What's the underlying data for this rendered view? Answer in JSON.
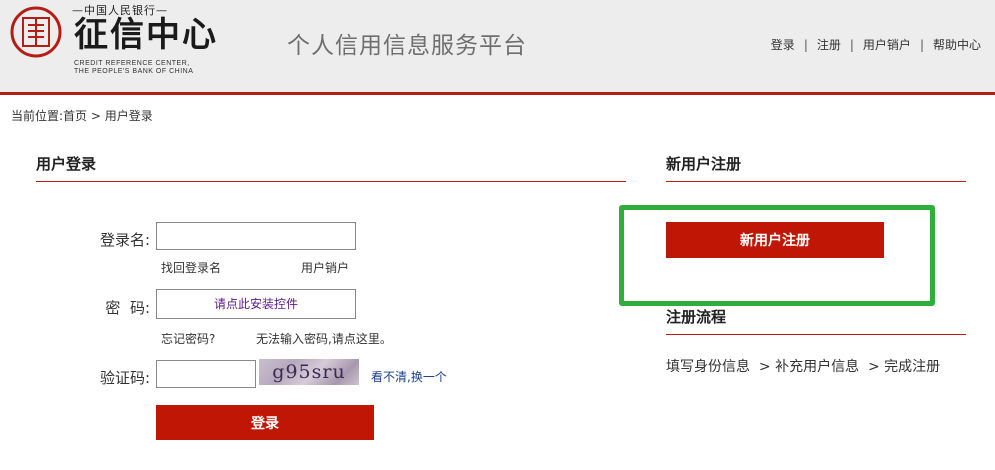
{
  "header": {
    "logo_top": "—中国人民银行—",
    "logo_cn": "征信中心",
    "logo_en_line1": "CREDIT REFERENCE CENTER,",
    "logo_en_line2": "THE PEOPLE'S BANK OF CHINA",
    "platform_title": "个人信用信息服务平台",
    "nav": [
      {
        "label": "登录"
      },
      {
        "label": "注册"
      },
      {
        "label": "用户销户"
      },
      {
        "label": "帮助中心"
      }
    ],
    "accent_color": "#b41e14"
  },
  "breadcrumb": {
    "prefix": "当前位置:",
    "home": "首页",
    "current": "> 用户登录"
  },
  "login": {
    "title": "用户登录",
    "username_label": "登录名:",
    "username_value": "",
    "recover_username": "找回登录名",
    "cancel_account": "用户销户",
    "password_label": "密  码:",
    "install_control": "请点此安装控件",
    "forgot_password": "忘记密码?",
    "cannot_input": "无法输入密码,请点这里。",
    "captcha_label": "验证码:",
    "captcha_value": "",
    "captcha_text": "g95sru",
    "captcha_refresh": "看不清,换一个",
    "submit": "登录",
    "button_color": "#c01606"
  },
  "register": {
    "title": "新用户注册",
    "button": "新用户注册",
    "highlight_color": "#2fae3c"
  },
  "flow": {
    "title": "注册流程",
    "steps": "填写身份信息  > 补充用户信息  > 完成注册"
  }
}
